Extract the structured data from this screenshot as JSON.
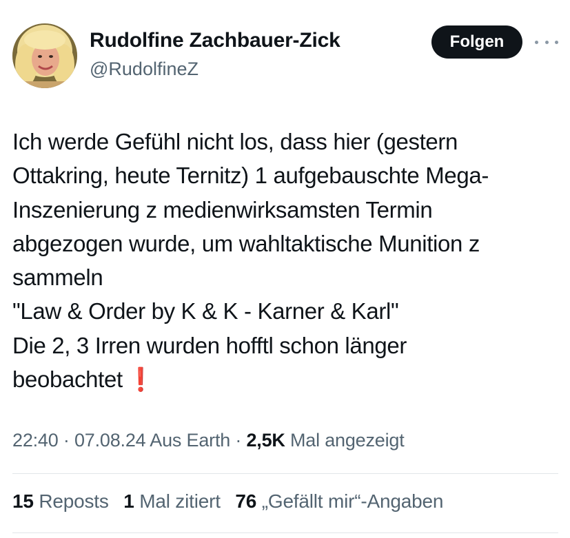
{
  "author": {
    "display_name": "Rudolfine Zachbauer-Zick",
    "handle": "@RudolfineZ",
    "avatar_icon": "profile-photo"
  },
  "actions": {
    "follow_label": "Folgen",
    "more_icon": "more-horizontal-icon"
  },
  "tweet": {
    "lines": [
      "Ich werde Gefühl nicht los, dass hier (gestern",
      "Ottakring, heute Ternitz) 1 aufgebauschte Mega-",
      "Inszenierung z medienwirksamsten Termin",
      "abgezogen wurde, um wahltaktische Munition z",
      "sammeln",
      "\"Law & Order by K & K - Karner & Karl\"",
      "Die 2, 3 Irren wurden hofftl schon länger",
      "beobachtet"
    ],
    "emoji": "❗"
  },
  "meta": {
    "time": "22:40",
    "sep1": " · ",
    "date": "07.08.24",
    "location": " Aus Earth",
    "sep2": " · ",
    "views_count": "2,5K",
    "views_label": " Mal angezeigt"
  },
  "stats": {
    "reposts_count": "15",
    "reposts_label": " Reposts",
    "quotes_count": "1",
    "quotes_label": " Mal zitiert",
    "likes_count": "76",
    "likes_label": " „Gefällt mir“-Angaben"
  },
  "colors": {
    "text": "#0f1419",
    "secondary": "#536471",
    "button_bg": "#0f1419",
    "divider": "#e1e5e9",
    "exclamation": "#e0245e"
  }
}
